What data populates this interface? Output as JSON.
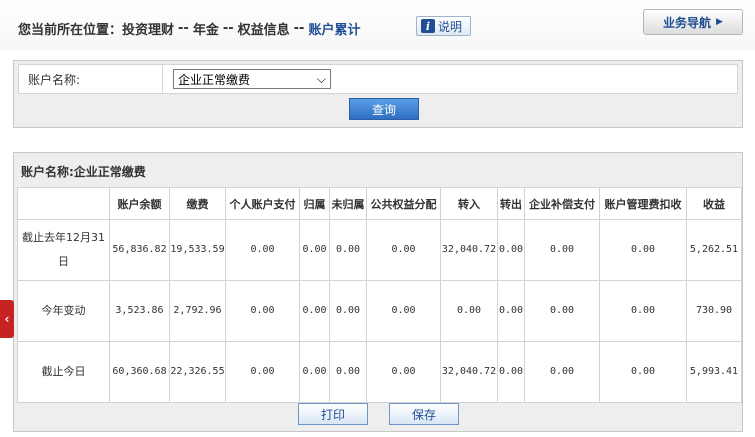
{
  "header": {
    "breadcrumb_prefix": "您当前所在位置：",
    "crumbs": [
      "投资理财",
      "年金",
      "权益信息",
      "账户累计"
    ],
    "separator": "--",
    "help_label": "说明",
    "nav_label": "业务导航"
  },
  "form": {
    "account_label": "账户名称:",
    "account_value": "企业正常缴费",
    "query_label": "查询"
  },
  "result": {
    "title": "账户名称:企业正常缴费",
    "columns": [
      "",
      "账户余额",
      "缴费",
      "个人账户支付",
      "归属",
      "未归属",
      "公共权益分配",
      "转入",
      "转出",
      "企业补偿支付",
      "账户管理费扣收",
      "收益"
    ],
    "rows": [
      [
        "截止去年12月31日",
        "56,836.82",
        "19,533.59",
        "0.00",
        "0.00",
        "0.00",
        "0.00",
        "32,040.72",
        "0.00",
        "0.00",
        "0.00",
        "5,262.51"
      ],
      [
        "今年变动",
        "3,523.86",
        "2,792.96",
        "0.00",
        "0.00",
        "0.00",
        "0.00",
        "0.00",
        "0.00",
        "0.00",
        "0.00",
        "730.90"
      ],
      [
        "截止今日",
        "60,360.68",
        "22,326.55",
        "0.00",
        "0.00",
        "0.00",
        "0.00",
        "32,040.72",
        "0.00",
        "0.00",
        "0.00",
        "5,993.41"
      ]
    ],
    "print_label": "打印",
    "save_label": "保存"
  },
  "icons": {
    "help": "info-icon",
    "nav": "caret-right-icon",
    "select": "chevron-down-icon",
    "side": "chevron-left-icon"
  },
  "colors": {
    "accent": "#1f4e94",
    "primary_button": "#2e6fc4",
    "side_tab": "#c82323"
  }
}
